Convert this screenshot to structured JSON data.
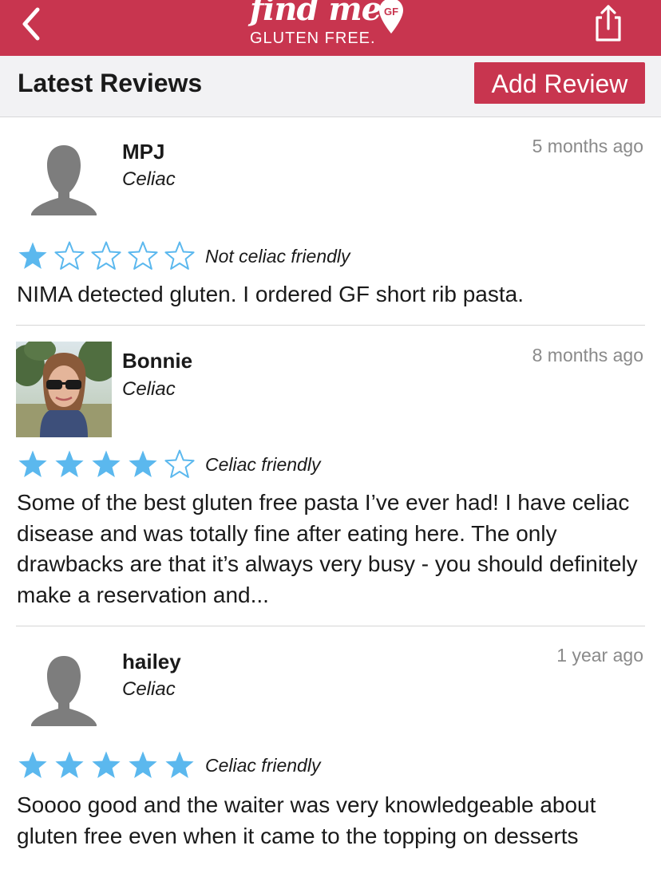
{
  "nav": {
    "logo_script": "find me",
    "logo_badge": "GF",
    "logo_sub": "GLUTEN FREE."
  },
  "header": {
    "title": "Latest Reviews",
    "add_review_label": "Add Review"
  },
  "reviews": [
    {
      "name": "MPJ",
      "role": "Celiac",
      "time": "5 months ago",
      "rating": 1,
      "friendly": "Not celiac friendly",
      "text": "NIMA detected gluten. I ordered GF short rib pasta.",
      "avatar": "default-person-icon"
    },
    {
      "name": "Bonnie",
      "role": "Celiac",
      "time": "8 months ago",
      "rating": 4,
      "friendly": "Celiac friendly",
      "text": "Some of the best gluten free pasta I’ve ever had! I have celiac disease and was totally fine after eating here. The only drawbacks are that it’s always very busy - you should definitely make a reservation and...",
      "avatar": "user-photo"
    },
    {
      "name": "hailey",
      "role": "Celiac",
      "time": "1 year ago",
      "rating": 5,
      "friendly": "Celiac friendly",
      "text": "Soooo good and the waiter was very knowledgeable about gluten free even when it came to the topping on desserts",
      "avatar": "default-person-icon"
    }
  ],
  "colors": {
    "brand": "#c8354f",
    "star": "#5bb8ee",
    "muted": "#8a8a8a",
    "avatar_gray": "#7d7d7d"
  },
  "icons": {
    "back": "chevron-left-icon",
    "share": "share-icon",
    "star_filled": "star-filled-icon",
    "star_outline": "star-outline-icon"
  }
}
